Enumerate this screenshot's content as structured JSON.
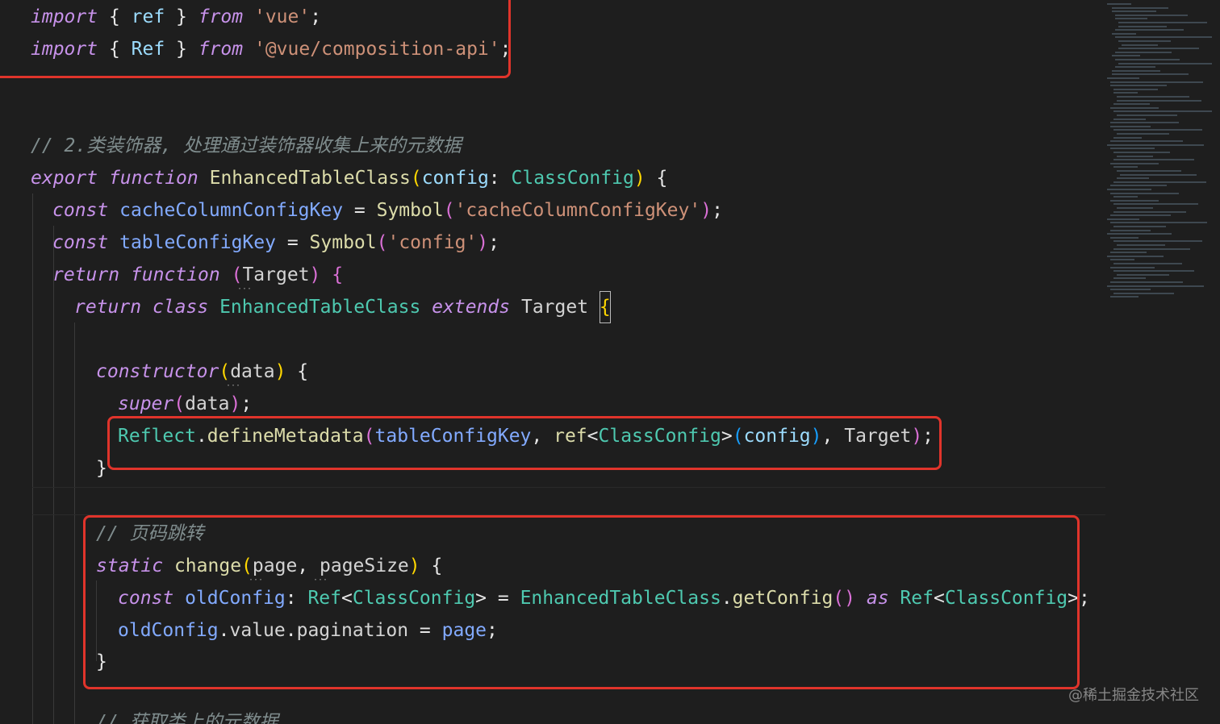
{
  "code_lines": [
    {
      "tokens": [
        {
          "t": "import",
          "c": "kw"
        },
        {
          "t": " { ",
          "c": "op"
        },
        {
          "t": "ref",
          "c": "param"
        },
        {
          "t": " } ",
          "c": "op"
        },
        {
          "t": "from",
          "c": "kw"
        },
        {
          "t": " ",
          "c": "op"
        },
        {
          "t": "'vue'",
          "c": "str"
        },
        {
          "t": ";",
          "c": "op"
        }
      ]
    },
    {
      "tokens": [
        {
          "t": "import",
          "c": "kw"
        },
        {
          "t": " { ",
          "c": "op"
        },
        {
          "t": "Ref",
          "c": "param"
        },
        {
          "t": " } ",
          "c": "op"
        },
        {
          "t": "from",
          "c": "kw"
        },
        {
          "t": " ",
          "c": "op"
        },
        {
          "t": "'@vue/composition-api'",
          "c": "str"
        },
        {
          "t": ";",
          "c": "op"
        }
      ]
    },
    {
      "tokens": [
        {
          "t": "// 2.类装饰器, 处理通过装饰器收集上来的元数据",
          "c": "comment"
        }
      ]
    },
    {
      "tokens": [
        {
          "t": "export",
          "c": "kw"
        },
        {
          "t": " ",
          "c": "op"
        },
        {
          "t": "function",
          "c": "kw"
        },
        {
          "t": " ",
          "c": "op"
        },
        {
          "t": "EnhancedTableClass",
          "c": "call"
        },
        {
          "t": "(",
          "c": "brk1"
        },
        {
          "t": "config",
          "c": "param"
        },
        {
          "t": ": ",
          "c": "op"
        },
        {
          "t": "ClassConfig",
          "c": "typ"
        },
        {
          "t": ")",
          "c": "brk1"
        },
        {
          "t": " {",
          "c": "op"
        }
      ]
    },
    {
      "tokens": [
        {
          "t": "const",
          "c": "kw"
        },
        {
          "t": " ",
          "c": "op"
        },
        {
          "t": "cacheColumnConfigKey",
          "c": "fn"
        },
        {
          "t": " = ",
          "c": "op"
        },
        {
          "t": "Symbol",
          "c": "call"
        },
        {
          "t": "(",
          "c": "brk2"
        },
        {
          "t": "'cacheColumnConfigKey'",
          "c": "str"
        },
        {
          "t": ")",
          "c": "brk2"
        },
        {
          "t": ";",
          "c": "op"
        }
      ]
    },
    {
      "tokens": [
        {
          "t": "const",
          "c": "kw"
        },
        {
          "t": " ",
          "c": "op"
        },
        {
          "t": "tableConfigKey",
          "c": "fn"
        },
        {
          "t": " = ",
          "c": "op"
        },
        {
          "t": "Symbol",
          "c": "call"
        },
        {
          "t": "(",
          "c": "brk2"
        },
        {
          "t": "'config'",
          "c": "str"
        },
        {
          "t": ")",
          "c": "brk2"
        },
        {
          "t": ";",
          "c": "op"
        }
      ]
    },
    {
      "tokens": [
        {
          "t": "return",
          "c": "kw"
        },
        {
          "t": " ",
          "c": "op"
        },
        {
          "t": "function",
          "c": "kw"
        },
        {
          "t": " ",
          "c": "op"
        },
        {
          "t": "(",
          "c": "brk2"
        },
        {
          "t": "Target",
          "c": "var"
        },
        {
          "t": ")",
          "c": "brk2"
        },
        {
          "t": " ",
          "c": "op"
        },
        {
          "t": "{",
          "c": "brk2"
        }
      ]
    },
    {
      "tokens": [
        {
          "t": "return",
          "c": "kw"
        },
        {
          "t": " ",
          "c": "op"
        },
        {
          "t": "class",
          "c": "kw"
        },
        {
          "t": " ",
          "c": "op"
        },
        {
          "t": "EnhancedTableClass",
          "c": "cls"
        },
        {
          "t": " ",
          "c": "op"
        },
        {
          "t": "extends",
          "c": "kw"
        },
        {
          "t": " ",
          "c": "op"
        },
        {
          "t": "Target",
          "c": "var"
        },
        {
          "t": " ",
          "c": "op"
        },
        {
          "t": "{",
          "c": "brk1 cursor"
        }
      ]
    },
    {
      "tokens": [
        {
          "t": "constructor",
          "c": "kw"
        },
        {
          "t": "(",
          "c": "brk1"
        },
        {
          "t": "data",
          "c": "var"
        },
        {
          "t": ")",
          "c": "brk1"
        },
        {
          "t": " {",
          "c": "op"
        }
      ]
    },
    {
      "tokens": [
        {
          "t": "super",
          "c": "kw"
        },
        {
          "t": "(",
          "c": "brk2"
        },
        {
          "t": "data",
          "c": "var"
        },
        {
          "t": ")",
          "c": "brk2"
        },
        {
          "t": ";",
          "c": "op"
        }
      ]
    },
    {
      "tokens": [
        {
          "t": "Reflect",
          "c": "cls"
        },
        {
          "t": ".",
          "c": "op"
        },
        {
          "t": "defineMetadata",
          "c": "call"
        },
        {
          "t": "(",
          "c": "brk2"
        },
        {
          "t": "tableConfigKey",
          "c": "fn"
        },
        {
          "t": ", ",
          "c": "op"
        },
        {
          "t": "ref",
          "c": "call"
        },
        {
          "t": "<",
          "c": "op"
        },
        {
          "t": "ClassConfig",
          "c": "typ"
        },
        {
          "t": ">",
          "c": "op"
        },
        {
          "t": "(",
          "c": "brk3"
        },
        {
          "t": "config",
          "c": "param"
        },
        {
          "t": ")",
          "c": "brk3"
        },
        {
          "t": ", ",
          "c": "op"
        },
        {
          "t": "Target",
          "c": "var"
        },
        {
          "t": ")",
          "c": "brk2"
        },
        {
          "t": ";",
          "c": "op"
        }
      ]
    },
    {
      "tokens": [
        {
          "t": "}",
          "c": "op"
        }
      ]
    },
    {
      "tokens": [
        {
          "t": "// 页码跳转",
          "c": "comment"
        }
      ]
    },
    {
      "tokens": [
        {
          "t": "static",
          "c": "kw"
        },
        {
          "t": " ",
          "c": "op"
        },
        {
          "t": "change",
          "c": "call"
        },
        {
          "t": "(",
          "c": "brk1"
        },
        {
          "t": "page",
          "c": "var"
        },
        {
          "t": ", ",
          "c": "op"
        },
        {
          "t": "pageSize",
          "c": "var"
        },
        {
          "t": ")",
          "c": "brk1"
        },
        {
          "t": " {",
          "c": "op"
        }
      ]
    },
    {
      "tokens": [
        {
          "t": "const",
          "c": "kw"
        },
        {
          "t": " ",
          "c": "op"
        },
        {
          "t": "oldConfig",
          "c": "fn"
        },
        {
          "t": ": ",
          "c": "op"
        },
        {
          "t": "Ref",
          "c": "typ"
        },
        {
          "t": "<",
          "c": "op"
        },
        {
          "t": "ClassConfig",
          "c": "typ"
        },
        {
          "t": "> = ",
          "c": "op"
        },
        {
          "t": "EnhancedTableClass",
          "c": "cls"
        },
        {
          "t": ".",
          "c": "op"
        },
        {
          "t": "getConfig",
          "c": "call"
        },
        {
          "t": "()",
          "c": "brk2"
        },
        {
          "t": " ",
          "c": "op"
        },
        {
          "t": "as",
          "c": "kw"
        },
        {
          "t": " ",
          "c": "op"
        },
        {
          "t": "Ref",
          "c": "typ"
        },
        {
          "t": "<",
          "c": "op"
        },
        {
          "t": "ClassConfig",
          "c": "typ"
        },
        {
          "t": ">;",
          "c": "op"
        }
      ]
    },
    {
      "tokens": [
        {
          "t": "oldConfig",
          "c": "fn"
        },
        {
          "t": ".",
          "c": "op"
        },
        {
          "t": "value",
          "c": "prop"
        },
        {
          "t": ".",
          "c": "op"
        },
        {
          "t": "pagination",
          "c": "prop"
        },
        {
          "t": " = ",
          "c": "op"
        },
        {
          "t": "page",
          "c": "fn"
        },
        {
          "t": ";",
          "c": "op"
        }
      ]
    },
    {
      "tokens": [
        {
          "t": "}",
          "c": "op"
        }
      ]
    },
    {
      "tokens": [
        {
          "t": "// 获取类上的元数据",
          "c": "comment"
        }
      ]
    }
  ],
  "watermark": "@稀土掘金技术社区",
  "colors": {
    "highlight_box": "#e0342b",
    "background": "#1e1e1e"
  }
}
